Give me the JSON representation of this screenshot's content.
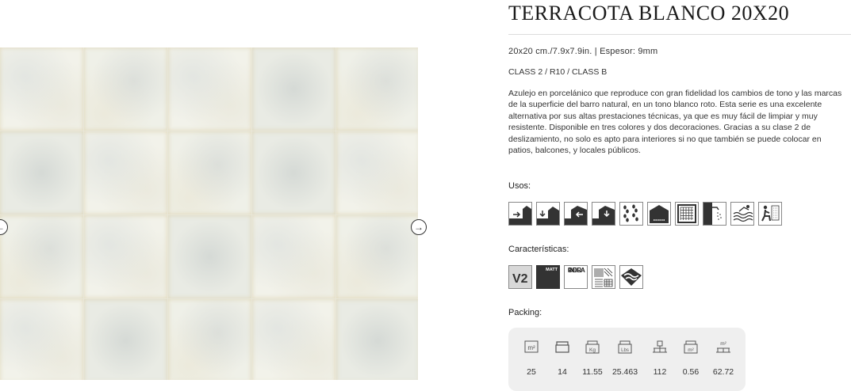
{
  "product": {
    "title": "TERRACOTA BLANCO 20X20",
    "spec": "20x20 cm./7.9x7.9in. | Espesor: 9mm",
    "classes": "CLASS 2 / R10 / CLASS B",
    "description": "Azulejo en porcelánico que reproduce con gran fidelidad los cambios de tono y las marcas de la superficie del barro natural, en un tono blanco roto. Esta serie es una excelente alternativa por sus altas prestaciones técnicas, ya que es muy fácil de limpiar y muy resistente. Disponible en tres colores y dos decoraciones. Gracias a su clase 2 de deslizamiento, no solo es apto para interiores si no que también se puede colocar en patios, balcones, y locales públicos."
  },
  "gallery": {
    "prev_icon": "circled-arrow-left-icon",
    "next_icon": "circled-arrow-right-icon",
    "prev_glyph": "←",
    "next_glyph": "→"
  },
  "usos": {
    "label": "Usos:",
    "icons": [
      "wall-exterior-icon",
      "floor-exterior-icon",
      "wall-interior-icon",
      "floor-interior-icon",
      "traffic-icon",
      "facade-icon",
      "tiled-floor-icon",
      "shower-icon",
      "pool-icon",
      "sauna-icon"
    ]
  },
  "caracteristicas": {
    "label": "Características:",
    "icons": [
      "v2-variation-icon",
      "matt-finish-icon",
      "porcelain-icon",
      "rectified-icon",
      "frost-resistant-icon"
    ],
    "v2_text": "V2",
    "matt_text": "MATT",
    "porcelain_text": [
      "POR",
      "CELA",
      "IN"
    ]
  },
  "packing": {
    "label": "Packing:",
    "columns": [
      {
        "icon": "m2-icon",
        "value": "25",
        "unit": "m²"
      },
      {
        "icon": "box-icon",
        "value": "14",
        "unit": ""
      },
      {
        "icon": "kg-icon",
        "value": "11.55",
        "unit": "Kg"
      },
      {
        "icon": "lbs-icon",
        "value": "25.463",
        "unit": "Lbs"
      },
      {
        "icon": "pallet-boxes-icon",
        "value": "112",
        "unit": ""
      },
      {
        "icon": "box-m2-icon",
        "value": "0.56",
        "unit": "m²"
      },
      {
        "icon": "pallet-m2-icon",
        "value": "62.72",
        "unit": "m²"
      }
    ]
  }
}
